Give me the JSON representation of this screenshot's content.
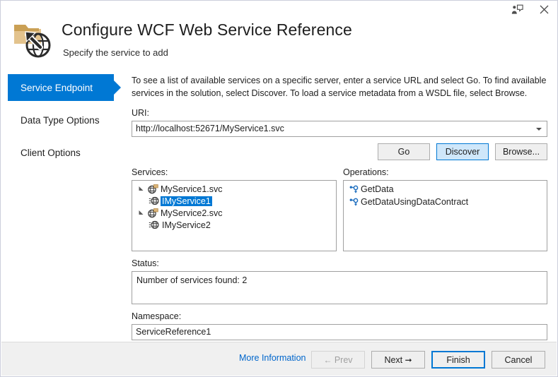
{
  "window": {
    "feedback_icon": "feedback-person-speech-icon",
    "close_icon": "close-x-icon"
  },
  "header": {
    "icon": "folder-globe-arrow-icon",
    "title": "Configure WCF Web Service Reference",
    "subtitle": "Specify the service to add"
  },
  "sidebar": {
    "items": [
      {
        "label": "Service Endpoint",
        "selected": true
      },
      {
        "label": "Data Type Options",
        "selected": false
      },
      {
        "label": "Client Options",
        "selected": false
      }
    ]
  },
  "main": {
    "intro": "To see a list of available services on a specific server, enter a service URL and select Go. To find available services in the solution, select Discover.  To load a service metadata from a WSDL file, select Browse.",
    "uri": {
      "label": "URI:",
      "value": "http://localhost:52671/MyService1.svc",
      "dropdown_icon": "chevron-down-icon"
    },
    "action_buttons": [
      {
        "label": "Go",
        "state": "normal"
      },
      {
        "label": "Discover",
        "state": "focused"
      },
      {
        "label": "Browse...",
        "state": "normal"
      }
    ],
    "services": {
      "label": "Services:",
      "nodes": [
        {
          "label": "MyService1.svc",
          "icon": "wcf-service-icon",
          "expander": "expanded-triangle-icon",
          "expanded": true,
          "selected": false,
          "children": [
            {
              "label": "IMyService1",
              "icon": "service-contract-globe-icon",
              "selected": true
            }
          ]
        },
        {
          "label": "MyService2.svc",
          "icon": "wcf-service-icon",
          "expander": "expanded-triangle-icon",
          "expanded": true,
          "selected": false,
          "children": [
            {
              "label": "IMyService2",
              "icon": "service-contract-globe-icon",
              "selected": false
            }
          ]
        }
      ]
    },
    "operations": {
      "label": "Operations:",
      "items": [
        {
          "label": "GetData",
          "icon": "operation-method-icon"
        },
        {
          "label": "GetDataUsingDataContract",
          "icon": "operation-method-icon"
        }
      ]
    },
    "status": {
      "label": "Status:",
      "message": "Number of services found: 2"
    },
    "namespace": {
      "label": "Namespace:",
      "value": "ServiceReference1"
    }
  },
  "footer": {
    "more_information": "More Information",
    "prev": "Prev",
    "prev_icon": "arrow-left-icon",
    "next": "Next",
    "next_icon": "arrow-right-icon",
    "finish": "Finish",
    "cancel": "Cancel"
  },
  "colors": {
    "accent": "#0078d4",
    "link": "#0066cc",
    "selection": "#0078d4",
    "folder_gold": "#d9b06a",
    "icon_dark": "#2b2b2b",
    "footer_bg": "#f0f0f0"
  }
}
